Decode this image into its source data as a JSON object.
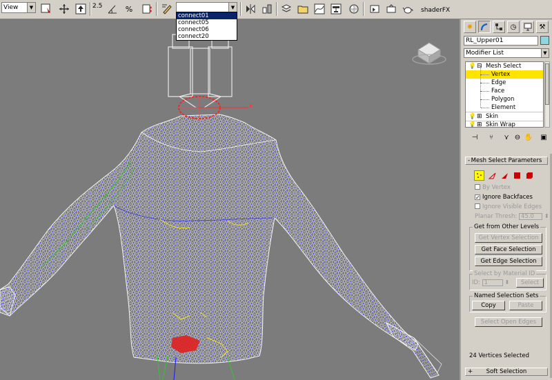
{
  "toolbar": {
    "view_combo": "View",
    "snap_value": "2.5",
    "selection_set_value": "",
    "selection_set_options": [
      "connect01",
      "connect05",
      "connect06",
      "connect20"
    ],
    "selected_option_index": 0,
    "shaderfx_label": "shaderFX"
  },
  "viewport": {
    "background": "#7c7c7c",
    "wire_color": "#ffffff",
    "vertex_color": "#1818ff",
    "selected_color": "#ff2020"
  },
  "panel": {
    "object_name": "RL_Upper01",
    "object_color": "#8ed6e0",
    "modifier_list_label": "Modifier List",
    "stack": [
      {
        "label": "Mesh Select",
        "indent": 0,
        "icons": "bulb-minus"
      },
      {
        "label": "Vertex",
        "indent": 1,
        "highlighted": true
      },
      {
        "label": "Edge",
        "indent": 1
      },
      {
        "label": "Face",
        "indent": 1
      },
      {
        "label": "Polygon",
        "indent": 1
      },
      {
        "label": "Element",
        "indent": 1
      },
      {
        "label": "Skin",
        "indent": 0,
        "icons": "bulb-plus"
      },
      {
        "label": "Skin Wrap",
        "indent": 0,
        "icons": "bulb-plus"
      }
    ],
    "mesh_select": {
      "title": "Mesh Select Parameters",
      "toggle": "-",
      "by_vertex_label": "By Vertex",
      "ignore_backfaces_label": "Ignore Backfaces",
      "ignore_backfaces_checked": true,
      "ignore_visible_edges_label": "Ignore Visible Edges",
      "planar_thresh_label": "Planar Thresh:",
      "planar_thresh_value": "45.0",
      "get_from_other_levels_label": "Get from Other Levels",
      "get_vertex_selection": "Get Vertex Selection",
      "get_face_selection": "Get Face Selection",
      "get_edge_selection": "Get Edge Selection",
      "select_by_material_label": "Select by Material ID",
      "id_label": "ID:",
      "id_value": "1",
      "select_button": "Select",
      "named_sets_label": "Named Selection Sets",
      "copy_button": "Copy",
      "paste_button": "Paste",
      "select_open_edges": "Select Open Edges",
      "status": "24 Vertices Selected"
    },
    "soft_selection": {
      "title": "Soft Selection",
      "toggle": "+"
    }
  }
}
